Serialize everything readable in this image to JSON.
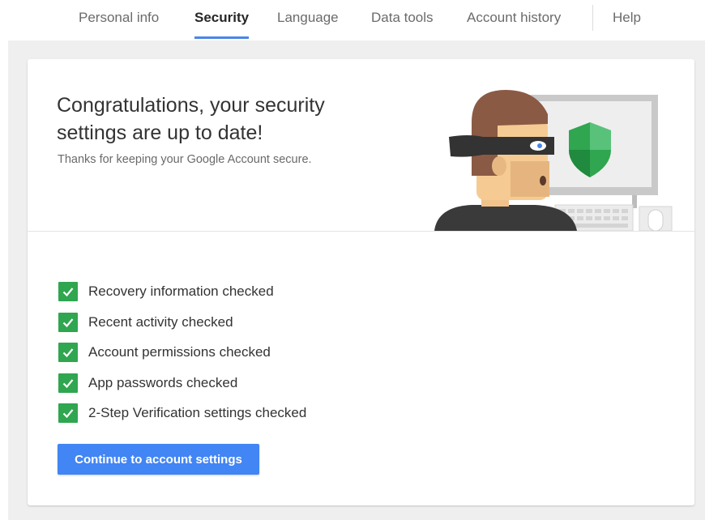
{
  "nav": {
    "tabs": [
      {
        "label": "Personal info"
      },
      {
        "label": "Security",
        "active": true
      },
      {
        "label": "Language"
      },
      {
        "label": "Data tools"
      },
      {
        "label": "Account history"
      }
    ],
    "help_label": "Help",
    "accent_color": "#4a86e8"
  },
  "hero": {
    "title": "Congratulations, your security settings are up to date!",
    "subtitle": "Thanks for keeping your Google Account secure.",
    "illustration_icon": "shield-icon"
  },
  "checklist": {
    "check_color": "#2fa64f",
    "items": [
      {
        "label": "Recovery information checked"
      },
      {
        "label": "Recent activity checked"
      },
      {
        "label": "Account permissions checked"
      },
      {
        "label": "App passwords checked"
      },
      {
        "label": "2-Step Verification settings checked"
      }
    ]
  },
  "actions": {
    "continue_label": "Continue to account settings",
    "button_color": "#4285f4"
  }
}
